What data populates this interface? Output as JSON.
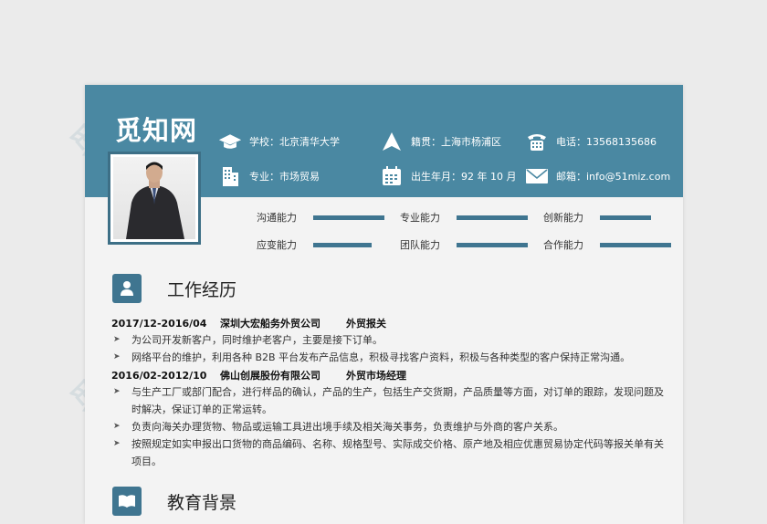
{
  "brand": "觅知网",
  "info": {
    "school": "学校：北京清华大学",
    "major": "专业：市场贸易",
    "hometown": "籍贯：上海市杨浦区",
    "birth": "出生年月：92 年 10 月",
    "phone": "电话：13568135686",
    "email": "邮箱：info@51miz.com"
  },
  "skills": [
    {
      "label": "沟通能力",
      "level": 0.78
    },
    {
      "label": "专业能力",
      "level": 0.78
    },
    {
      "label": "创新能力",
      "level": 0.56
    },
    {
      "label": "应变能力",
      "level": 0.64
    },
    {
      "label": "团队能力",
      "level": 0.78
    },
    {
      "label": "合作能力",
      "level": 0.78
    }
  ],
  "sections": {
    "work": "工作经历",
    "education": "教育背景"
  },
  "jobs": [
    {
      "date": "2017/12-2016/04",
      "company": "深圳大宏船务外贸公司",
      "title": "外贸报关",
      "bullets": [
        "为公司开发新客户，同时维护老客户，主要是接下订单。",
        "网络平台的维护，利用各种 B2B 平台发布产品信息，积极寻找客户资料，积极与各种类型的客户保持正常沟通。"
      ]
    },
    {
      "date": "2016/02-2012/10",
      "company": "佛山创展股份有限公司",
      "title": "外贸市场经理",
      "bullets": [
        "与生产工厂或部门配合，进行样品的确认，产品的生产，包括生产交货期，产品质量等方面，对订单的跟踪，发现问题及时解决，保证订单的正常运转。",
        "负责向海关办理货物、物品或运输工具进出境手续及相关海关事务，负责维护与外商的客户关系。",
        "按照规定如实申报出口货物的商品编码、名称、规格型号、实际成交价格、原产地及相应优惠贸易协定代码等报关单有关项目。"
      ]
    }
  ],
  "colors": {
    "header": "#4a88a2",
    "accent": "#3f7590"
  }
}
